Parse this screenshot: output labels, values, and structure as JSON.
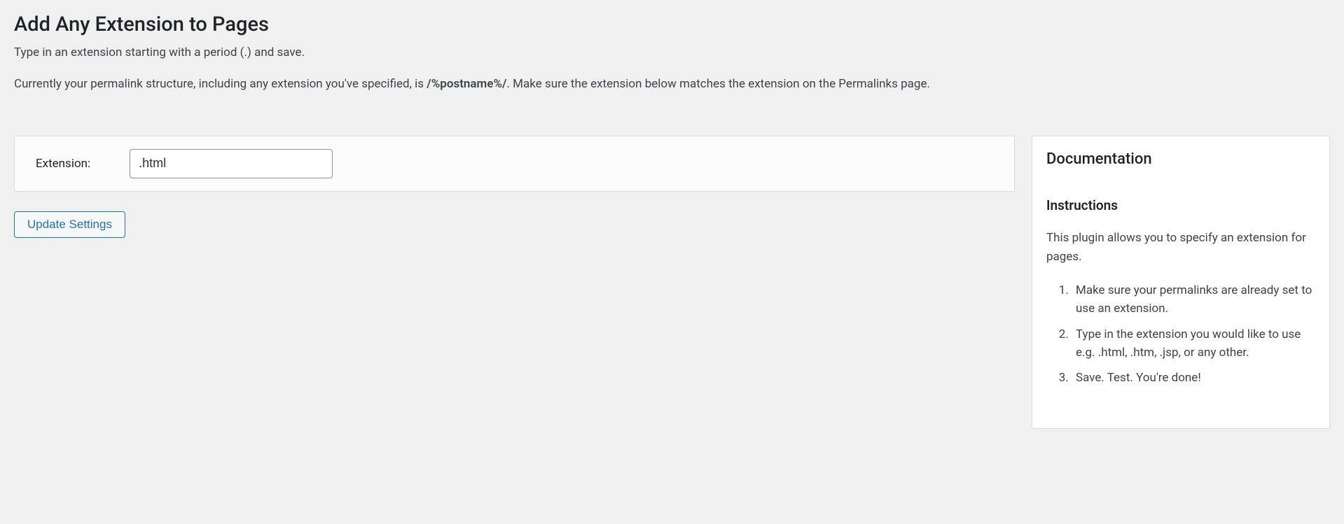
{
  "page": {
    "title": "Add Any Extension to Pages",
    "desc1": "Type in an extension starting with a period (.) and save.",
    "desc2_prefix": "Currently your permalink structure, including any extension you've specified, is ",
    "desc2_structure": "/%postname%/",
    "desc2_suffix": ". Make sure the extension below matches the extension on the Permalinks page."
  },
  "form": {
    "label": "Extension:",
    "value": ".html",
    "submit_label": "Update Settings"
  },
  "docs": {
    "title": "Documentation",
    "subtitle": "Instructions",
    "intro": "This plugin allows you to specify an extension for pages.",
    "steps": [
      "Make sure your permalinks are already set to use an extension.",
      "Type in the extension you would like to use e.g. .html, .htm, .jsp, or any other.",
      "Save. Test. You're done!"
    ]
  }
}
